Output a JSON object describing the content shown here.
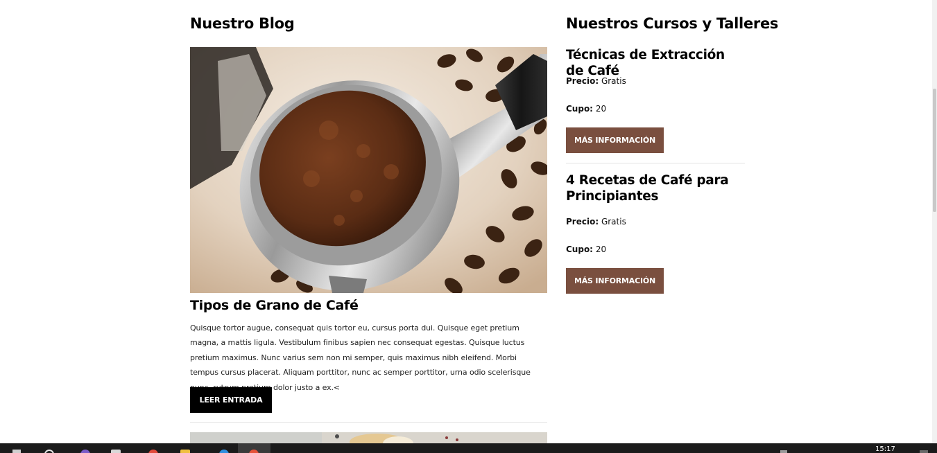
{
  "blog": {
    "heading": "Nuestro Blog",
    "post": {
      "title": "Tipos de Grano de Café",
      "excerpt": "Quisque tortor augue, consequat quis tortor eu, cursus porta dui. Quisque eget pretium magna, a mattis ligula. Vestibulum finibus sapien nec consequat egestas. Quisque luctus pretium maximus. Nunc varius sem non mi semper, quis maximus nibh eleifend. Morbi tempus cursus placerat. Aliquam porttitor, nunc ac semper porttitor, urna odio scelerisque nunc, rutrum pretium dolor justo a ex.<",
      "button_label": "LEER ENTRADA"
    }
  },
  "courses": {
    "heading": "Nuestros Cursos y Talleres",
    "items": [
      {
        "title": "Técnicas de Extracción de Café",
        "price_label": "Precio:",
        "price_value": "Gratis",
        "slots_label": "Cupo:",
        "slots_value": "20",
        "button_label": "MÁS INFORMACIÓN"
      },
      {
        "title": "4 Recetas de Café para Principiantes",
        "price_label": "Precio:",
        "price_value": "Gratis",
        "slots_label": "Cupo:",
        "slots_value": "20",
        "button_label": "MÁS INFORMACIÓN"
      }
    ]
  },
  "taskbar": {
    "clock": "15:17"
  },
  "colors": {
    "button_brown": "#7a4f3f",
    "button_dark": "#000000",
    "taskbar": "#1b1b1b"
  }
}
